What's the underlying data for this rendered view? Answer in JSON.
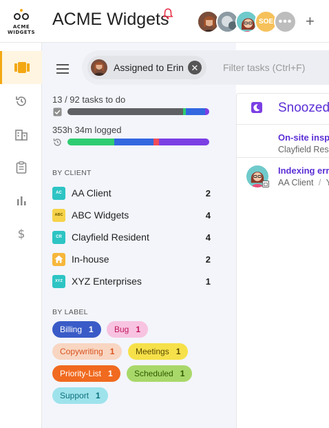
{
  "app": {
    "logo_text": "ACME\nWIDGETS",
    "logo_line1": "ACME",
    "logo_line2": "WIDGETS",
    "title": "ACME Widgets",
    "accent": "#f3a712",
    "bell_color": "#e8334a"
  },
  "header": {
    "avatar_initials": "SOE",
    "more_label": "•••",
    "add_label": "+"
  },
  "nav": {
    "items": [
      "tasks-icon",
      "history-icon",
      "clients-icon",
      "clipboard-icon",
      "reports-icon",
      "billing-icon"
    ]
  },
  "filter": {
    "chip_label": "Assigned to Erin",
    "close_label": "✕",
    "placeholder": "Filter tasks (Ctrl+F)"
  },
  "stats": {
    "tasks_text": "13 / 92 tasks to do",
    "logged_text": "353h 34m logged"
  },
  "clients": {
    "title": "BY CLIENT",
    "items": [
      {
        "badge": "AC",
        "name": "AA Client",
        "count": "2",
        "color": "#2ec4c4"
      },
      {
        "badge": "ABC",
        "name": "ABC Widgets",
        "count": "4",
        "color": "#f6d34a"
      },
      {
        "badge": "CR",
        "name": "Clayfield Resident",
        "count": "4",
        "color": "#2ec4c4"
      },
      {
        "badge": "home-icon",
        "name": "In-house",
        "count": "2",
        "color": "#f6b73c"
      },
      {
        "badge": "XYZ",
        "name": "XYZ Enterprises",
        "count": "1",
        "color": "#2ec4c4"
      }
    ]
  },
  "labels": {
    "title": "BY LABEL",
    "items": [
      {
        "name": "Billing",
        "count": "1",
        "bg": "#3a5bc7",
        "fg": "#ffffff"
      },
      {
        "name": "Bug",
        "count": "1",
        "bg": "#f7c3e0",
        "fg": "#c2185b"
      },
      {
        "name": "Copywriting",
        "count": "1",
        "bg": "#f8d6c2",
        "fg": "#d9531e"
      },
      {
        "name": "Meetings",
        "count": "1",
        "bg": "#f6e14a",
        "fg": "#5a4a00"
      },
      {
        "name": "Priority-List",
        "count": "1",
        "bg": "#f06a1f",
        "fg": "#ffffff"
      },
      {
        "name": "Scheduled",
        "count": "1",
        "bg": "#a9d86a",
        "fg": "#2f5a00"
      },
      {
        "name": "Support",
        "count": "1",
        "bg": "#9ee3ec",
        "fg": "#0b6f7a"
      }
    ]
  },
  "main": {
    "title": "Snoozed",
    "tasks": [
      {
        "title": "On-site insp",
        "client": "Clayfield Res"
      },
      {
        "title": "Indexing err",
        "client": "AA Client",
        "sep": "/",
        "more": "Y"
      }
    ]
  }
}
